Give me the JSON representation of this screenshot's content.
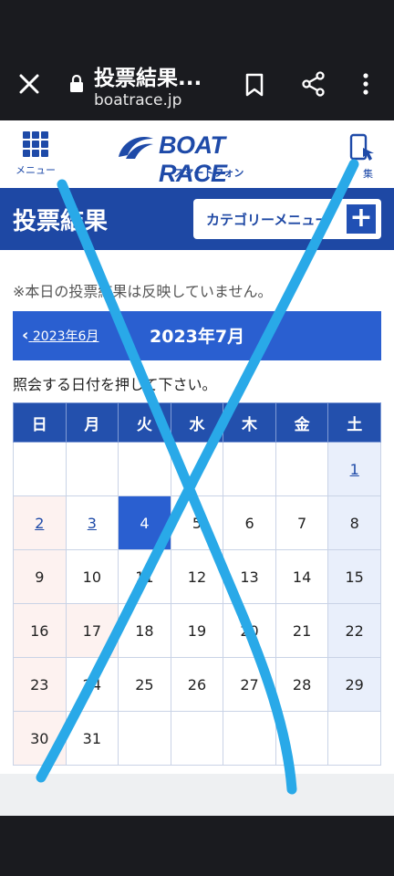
{
  "browser": {
    "tab_title": "投票結果...",
    "domain": "boatrace.jp"
  },
  "site": {
    "menu_label": "メニュー",
    "logo_text": "BOAT RACE",
    "logo_sub": "スマートフォン",
    "phone_label": "集"
  },
  "page": {
    "title": "投票結果",
    "category_button": "カテゴリーメニュー",
    "notice": "※本日の投票結果は反映していません。",
    "prev_month": "2023年6月",
    "current_month": "2023年7月",
    "instruction": "照会する日付を押して下さい。"
  },
  "calendar": {
    "weekdays": [
      "日",
      "月",
      "火",
      "水",
      "木",
      "金",
      "土"
    ],
    "weeks": [
      [
        "",
        "",
        "",
        "",
        "",
        "",
        "1"
      ],
      [
        "2",
        "3",
        "4",
        "5",
        "6",
        "7",
        "8"
      ],
      [
        "9",
        "10",
        "11",
        "12",
        "13",
        "14",
        "15"
      ],
      [
        "16",
        "17",
        "18",
        "19",
        "20",
        "21",
        "22"
      ],
      [
        "23",
        "24",
        "25",
        "26",
        "27",
        "28",
        "29"
      ],
      [
        "30",
        "31",
        "",
        "",
        "",
        "",
        ""
      ]
    ],
    "linked_days": [
      "1",
      "2",
      "3"
    ],
    "selected_day": "4",
    "pink_days": [
      "2",
      "9",
      "16",
      "17",
      "23",
      "30"
    ]
  },
  "colors": {
    "brand_blue": "#1e48a4",
    "annotation_stroke": "#29a9e8"
  }
}
